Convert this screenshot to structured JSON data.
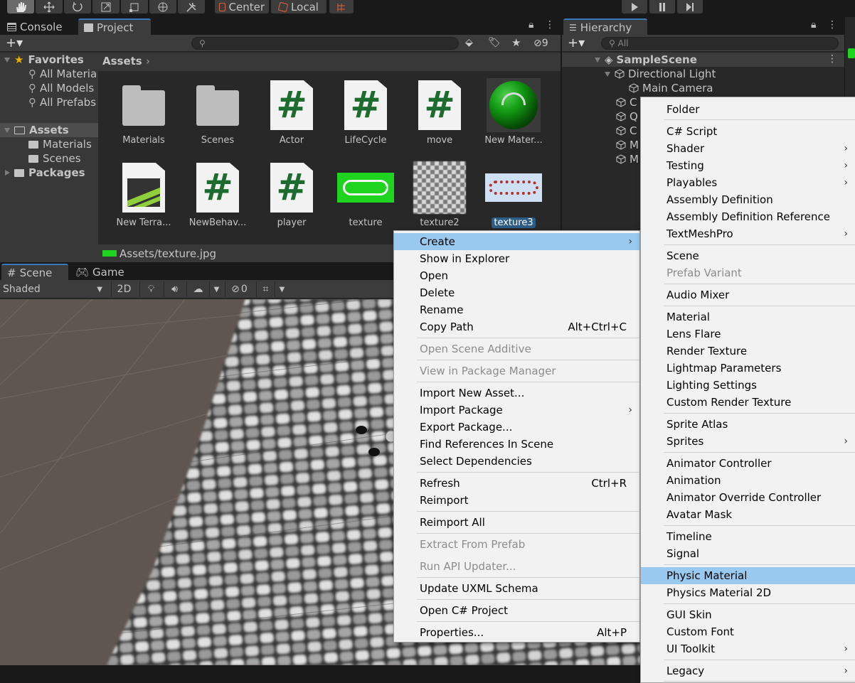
{
  "toolbar": {
    "pivot_label": "Center",
    "space_label": "Local"
  },
  "project": {
    "tabs": [
      "Console",
      "Project"
    ],
    "hidden_count": "9",
    "tree": {
      "favorites": "Favorites",
      "fav_items": [
        "All Materia",
        "All Models",
        "All Prefabs"
      ],
      "assets": "Assets",
      "asset_items": [
        "Materials",
        "Scenes"
      ],
      "packages": "Packages"
    },
    "breadcrumb": "Assets",
    "items_row1": [
      "Materials",
      "Scenes",
      "Actor",
      "LifeCycle",
      "move",
      "New Mater..."
    ],
    "items_row2": [
      "New Terra...",
      "NewBehav...",
      "player",
      "texture",
      "texture2",
      "texture3"
    ],
    "status_path": "Assets/texture.jpg"
  },
  "hierarchy": {
    "tab": "Hierarchy",
    "search_placeholder": "All",
    "scene": "SampleScene",
    "items": [
      "Directional Light",
      "Main Camera"
    ],
    "partial_items": [
      "C",
      "Q",
      "C",
      "M",
      "M"
    ]
  },
  "scene": {
    "tabs": [
      "Scene",
      "Game"
    ],
    "shading": "Shaded",
    "mode_2d": "2D",
    "hidden_count": "0"
  },
  "context_menu": [
    {
      "label": "Create",
      "hl": true,
      "sub": true
    },
    {
      "label": "Show in Explorer"
    },
    {
      "label": "Open"
    },
    {
      "label": "Delete"
    },
    {
      "label": "Rename"
    },
    {
      "label": "Copy Path",
      "shortcut": "Alt+Ctrl+C"
    },
    {
      "label": "Open Scene Additive",
      "dis": true
    },
    {
      "label": "View in Package Manager",
      "dis": true
    },
    {
      "label": "Import New Asset..."
    },
    {
      "label": "Import Package",
      "sub": true
    },
    {
      "label": "Export Package..."
    },
    {
      "label": "Find References In Scene"
    },
    {
      "label": "Select Dependencies"
    },
    {
      "label": "Refresh",
      "shortcut": "Ctrl+R"
    },
    {
      "label": "Reimport"
    },
    {
      "label": "Reimport All"
    },
    {
      "label": "Extract From Prefab",
      "dis": true
    },
    {
      "label": "Run API Updater...",
      "dis": true
    },
    {
      "label": "Update UXML Schema"
    },
    {
      "label": "Open C# Project"
    },
    {
      "label": "Properties...",
      "shortcut": "Alt+P"
    }
  ],
  "create_menu": [
    {
      "label": "Folder"
    },
    {
      "label": "C# Script"
    },
    {
      "label": "Shader",
      "sub": true
    },
    {
      "label": "Testing",
      "sub": true
    },
    {
      "label": "Playables",
      "sub": true
    },
    {
      "label": "Assembly Definition"
    },
    {
      "label": "Assembly Definition Reference"
    },
    {
      "label": "TextMeshPro",
      "sub": true
    },
    {
      "label": "Scene"
    },
    {
      "label": "Prefab Variant",
      "dis": true
    },
    {
      "label": "Audio Mixer"
    },
    {
      "label": "Material"
    },
    {
      "label": "Lens Flare"
    },
    {
      "label": "Render Texture"
    },
    {
      "label": "Lightmap Parameters"
    },
    {
      "label": "Lighting Settings"
    },
    {
      "label": "Custom Render Texture"
    },
    {
      "label": "Sprite Atlas"
    },
    {
      "label": "Sprites",
      "sub": true
    },
    {
      "label": "Animator Controller"
    },
    {
      "label": "Animation"
    },
    {
      "label": "Animator Override Controller"
    },
    {
      "label": "Avatar Mask"
    },
    {
      "label": "Timeline"
    },
    {
      "label": "Signal"
    },
    {
      "label": "Physic Material",
      "hl": true
    },
    {
      "label": "Physics Material 2D"
    },
    {
      "label": "GUI Skin"
    },
    {
      "label": "Custom Font"
    },
    {
      "label": "UI Toolkit",
      "sub": true
    },
    {
      "label": "Legacy",
      "sub": true
    }
  ]
}
